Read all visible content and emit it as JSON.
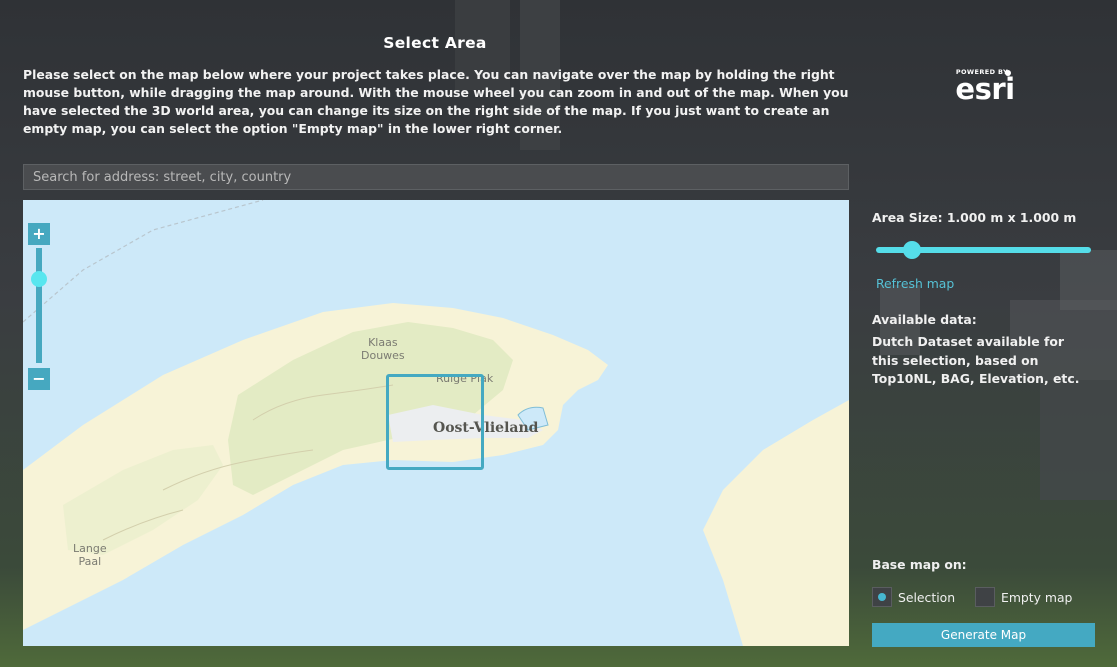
{
  "dialog": {
    "title": "Select Area",
    "intro": "Please select on the map below where your project takes place. You can navigate over the map by holding the right mouse button, while dragging the map around. With the mouse wheel you can zoom in and out of the map. When you have selected the 3D world area, you can change its size on the right side of the map. If you just want to create an empty map, you can select the option \"Empty map\" in the lower right corner."
  },
  "logo": {
    "powered_by": "POWERED BY",
    "brand": "esri"
  },
  "search": {
    "placeholder": "Search for address: street, city, country"
  },
  "map": {
    "zoom_in": "+",
    "zoom_out": "−",
    "zoom_level_fraction": 0.18,
    "labels": {
      "klaas_douwes_1": "Klaas",
      "klaas_douwes_2": "Douwes",
      "ruige_plak": "Ruige Plak",
      "oost_vlieland": "Oost-Vlieland",
      "lange_paal_1": "Lange",
      "lange_paal_2": "Paal"
    },
    "colors": {
      "water": "#cde9f9",
      "sand": "#f7f3d7",
      "vegetation": "#e6edc8",
      "selection": "#44a9c2"
    }
  },
  "sidebar": {
    "area_size_label": "Area Size: 1.000 m x 1.000 m",
    "area_slider_fraction": 0.15,
    "refresh_label": "Refresh map",
    "available_title": "Available data:",
    "available_text": "Dutch Dataset available for this selection, based on Top10NL, BAG, Elevation, etc.",
    "base_map_label": "Base map on:",
    "option_selection": "Selection",
    "option_empty": "Empty map",
    "selected_option": "Selection",
    "generate_label": "Generate Map"
  }
}
